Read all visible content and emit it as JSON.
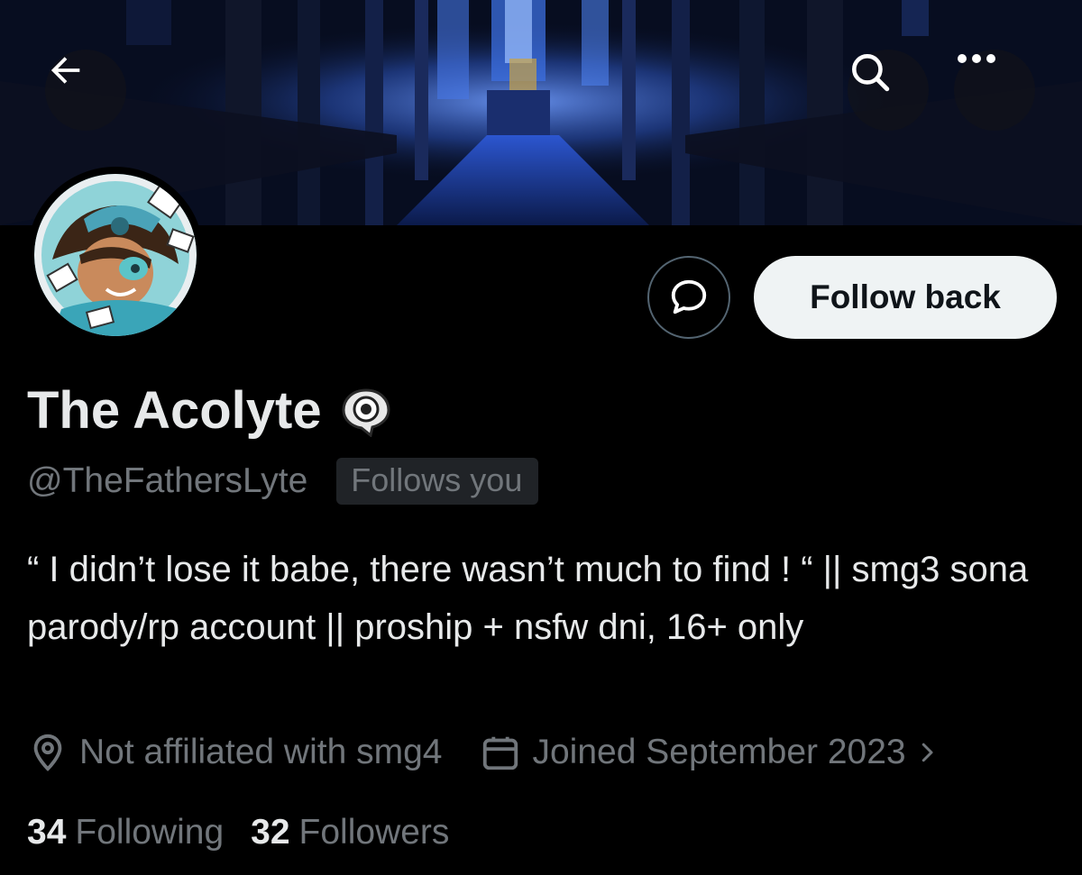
{
  "header": {
    "back_icon": "arrow-left-icon",
    "search_icon": "search-icon",
    "more_icon": "more-dots-icon"
  },
  "profile": {
    "display_name": "The Acolyte",
    "badge_icon": "eye-speech-bubble-icon",
    "handle": "@TheFathersLyte",
    "follows_you_label": "Follows you",
    "bio": "“ I didn’t lose it babe, there wasn’t much to find ! “ || smg3 sona parody/rp account || proship + nsfw dni, 16+ only",
    "location": "Not affiliated with smg4",
    "joined": "Joined September 2023",
    "following_count": "34",
    "following_label": "Following",
    "followers_count": "32",
    "followers_label": "Followers"
  },
  "actions": {
    "dm_icon": "message-bubble-icon",
    "follow_label": "Follow back"
  },
  "colors": {
    "background": "#000000",
    "primary_text": "#e7e9ea",
    "secondary_text": "#71767b",
    "follow_button_bg": "#eff3f4",
    "banner_blue": "#1b3a8c"
  }
}
